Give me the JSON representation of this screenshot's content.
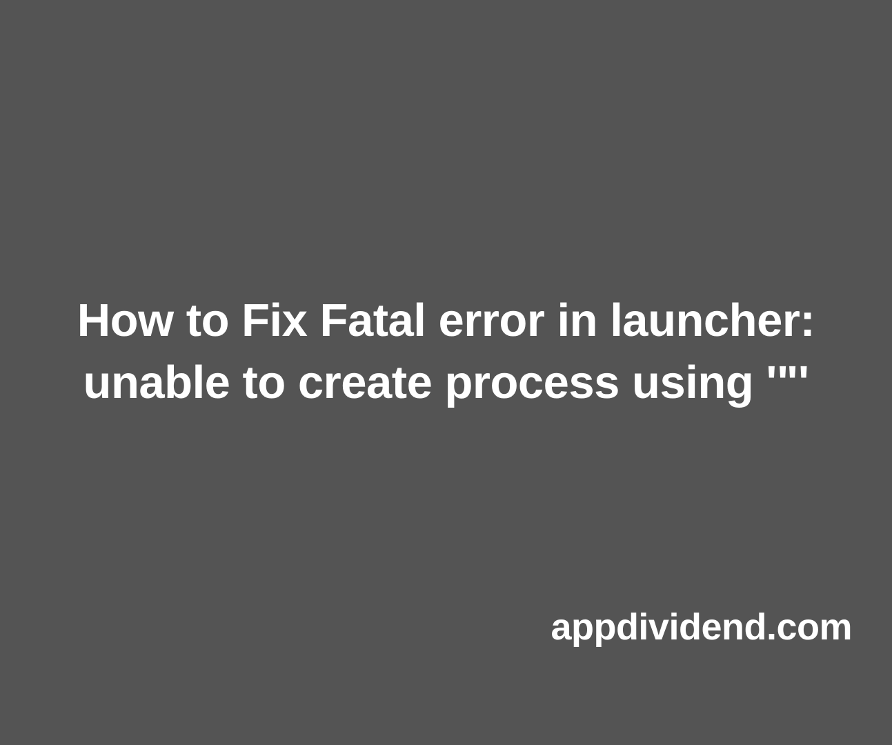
{
  "title": "How to Fix Fatal error in launcher: unable to create process using '\"'",
  "credit": "appdividend.com"
}
